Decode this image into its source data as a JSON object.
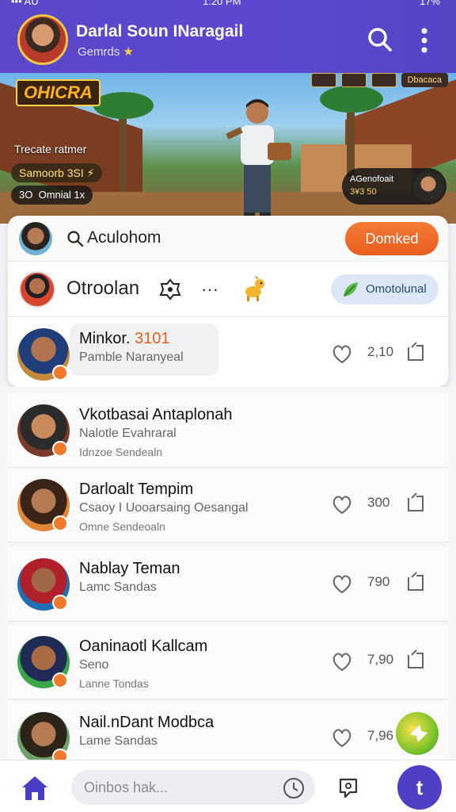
{
  "status": {
    "left": "••• AU",
    "time": "1:20 PM",
    "right": "17%"
  },
  "header": {
    "title": "Darlal Soun INaragail",
    "subtitle": "Gemrds"
  },
  "hero": {
    "game_logo": "OHICRA",
    "top_badge": "Dbacaca",
    "caption": "Trecate ratmer",
    "chip1": "Samoorb 3SI",
    "chip2_left": "3O",
    "chip2_right": "Omnial 1x",
    "card_line1": "AGenofoait",
    "card_line2": "3¥3 50"
  },
  "card": {
    "search_text": "Aculohom",
    "primary_button": "Domked",
    "profile_name": "Otroolan",
    "more_symbol": "···",
    "pill_label": "Omotolunal",
    "highlight": {
      "name": "Minkor.",
      "name_accent": "3101",
      "sub": "Pamble Naranyeal",
      "count": "2,10"
    }
  },
  "list": [
    {
      "name": "Vkotbasai Antaplonah",
      "sub1": "Nalotle Evahraral",
      "sub2": "Idnzoe Sendealn",
      "count": "",
      "colors": [
        "#c98a5e",
        "#2b2b2b",
        "#7a3b2a"
      ]
    },
    {
      "name": "Darloalt Tempim",
      "sub1": "Csaoy I Uooarsaing Oesangal",
      "sub2": "Omne Sendeoaln",
      "count": "300",
      "colors": [
        "#b57b55",
        "#3a2417",
        "#e0873a"
      ]
    },
    {
      "name": "Nablay Teman",
      "sub1": "Lamc Sandas",
      "sub2": "",
      "count": "790",
      "colors": [
        "#a26748",
        "#b0202a",
        "#1f6fb5"
      ]
    },
    {
      "name": "Oaninaotl Kallcam",
      "sub1": "Seno",
      "sub2": "Lanne Tondas",
      "count": "7,90",
      "colors": [
        "#a86b46",
        "#1f2a55",
        "#39a74a"
      ]
    },
    {
      "name": "Nail.nDant Modbca",
      "sub1": "Lame Sandas",
      "sub2": "",
      "count": "7,96",
      "colors": [
        "#b57b55",
        "#2d2419",
        "#6da36a"
      ]
    }
  ],
  "bottom": {
    "input_placeholder": "Oinbos hak...",
    "fab_label": "t"
  },
  "theme": {
    "primary": "#5a47c9",
    "accent": "#e85d1d",
    "pill": "#dce8f5"
  }
}
